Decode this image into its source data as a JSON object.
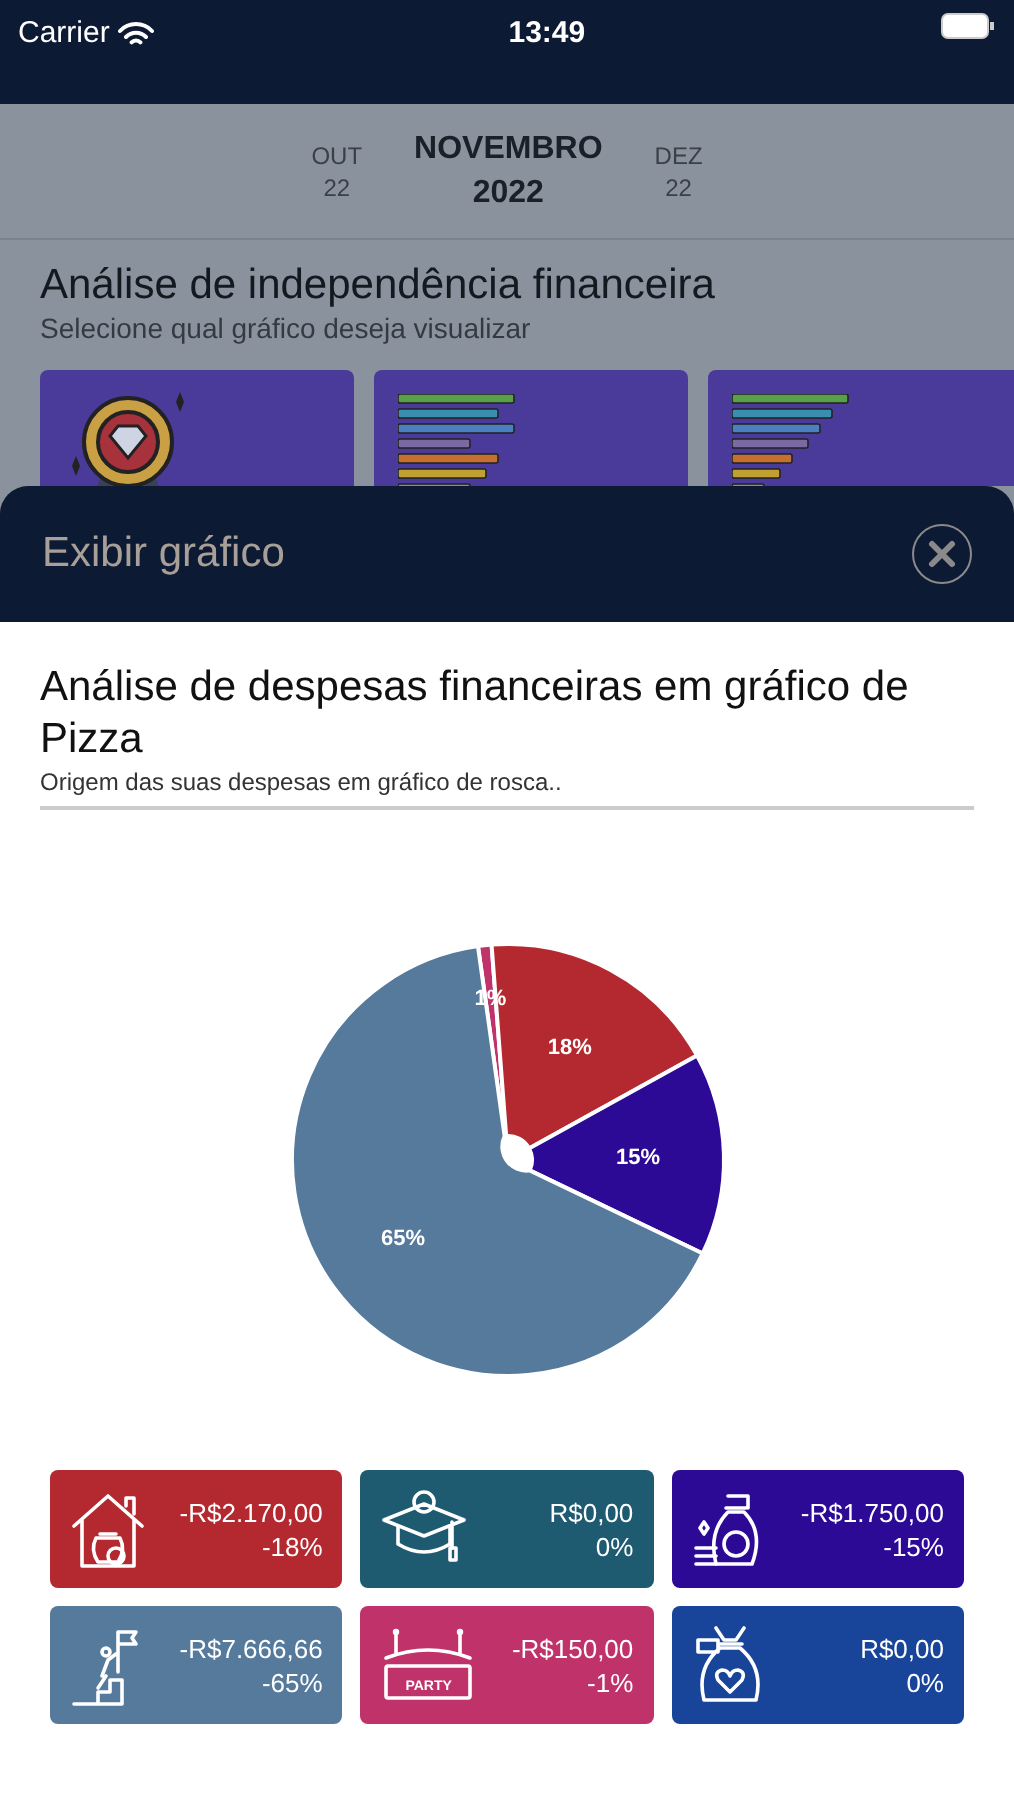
{
  "status_bar": {
    "carrier": "Carrier",
    "time": "13:49"
  },
  "month_nav": {
    "prev": {
      "month": "OUT",
      "year": "22"
    },
    "current": {
      "month": "NOVEMBRO",
      "year": "2022"
    },
    "next": {
      "month": "DEZ",
      "year": "22"
    }
  },
  "background_section": {
    "title": "Análise de independência financeira",
    "subtitle": "Selecione qual gráfico deseja visualizar",
    "options": [
      {
        "kind": "medal"
      },
      {
        "kind": "bars"
      },
      {
        "kind": "ranked"
      }
    ]
  },
  "sheet": {
    "title": "Exibir gráfico"
  },
  "chart_section": {
    "title": "Análise de despesas financeiras em gráfico de Pizza",
    "subtitle": "Origem das suas despesas em gráfico de rosca..",
    "chart_data": {
      "type": "pie",
      "values": [
        1,
        18,
        15,
        65
      ],
      "colors": [
        "#c0336a",
        "#b3292f",
        "#2c0a96",
        "#557a9c"
      ],
      "value_labels": [
        "1%",
        "18%",
        "15%",
        "65%"
      ]
    }
  },
  "categories": [
    {
      "kind": "house",
      "color": "#b3292f",
      "amount": "-R$2.170,00",
      "percent": "-18%"
    },
    {
      "kind": "graduation",
      "color": "#1e5a70",
      "amount": "R$0,00",
      "percent": "0%"
    },
    {
      "kind": "money-bag",
      "color": "#2c0a96",
      "amount": "-R$1.750,00",
      "percent": "-15%"
    },
    {
      "kind": "climb",
      "color": "#557a9c",
      "amount": "-R$7.666,66",
      "percent": "-65%"
    },
    {
      "kind": "party",
      "color": "#c0336a",
      "amount": "-R$150,00",
      "percent": "-1%",
      "icon_label": "PARTY"
    },
    {
      "kind": "heart-bag",
      "color": "#18449a",
      "amount": "R$0,00",
      "percent": "0%"
    }
  ]
}
